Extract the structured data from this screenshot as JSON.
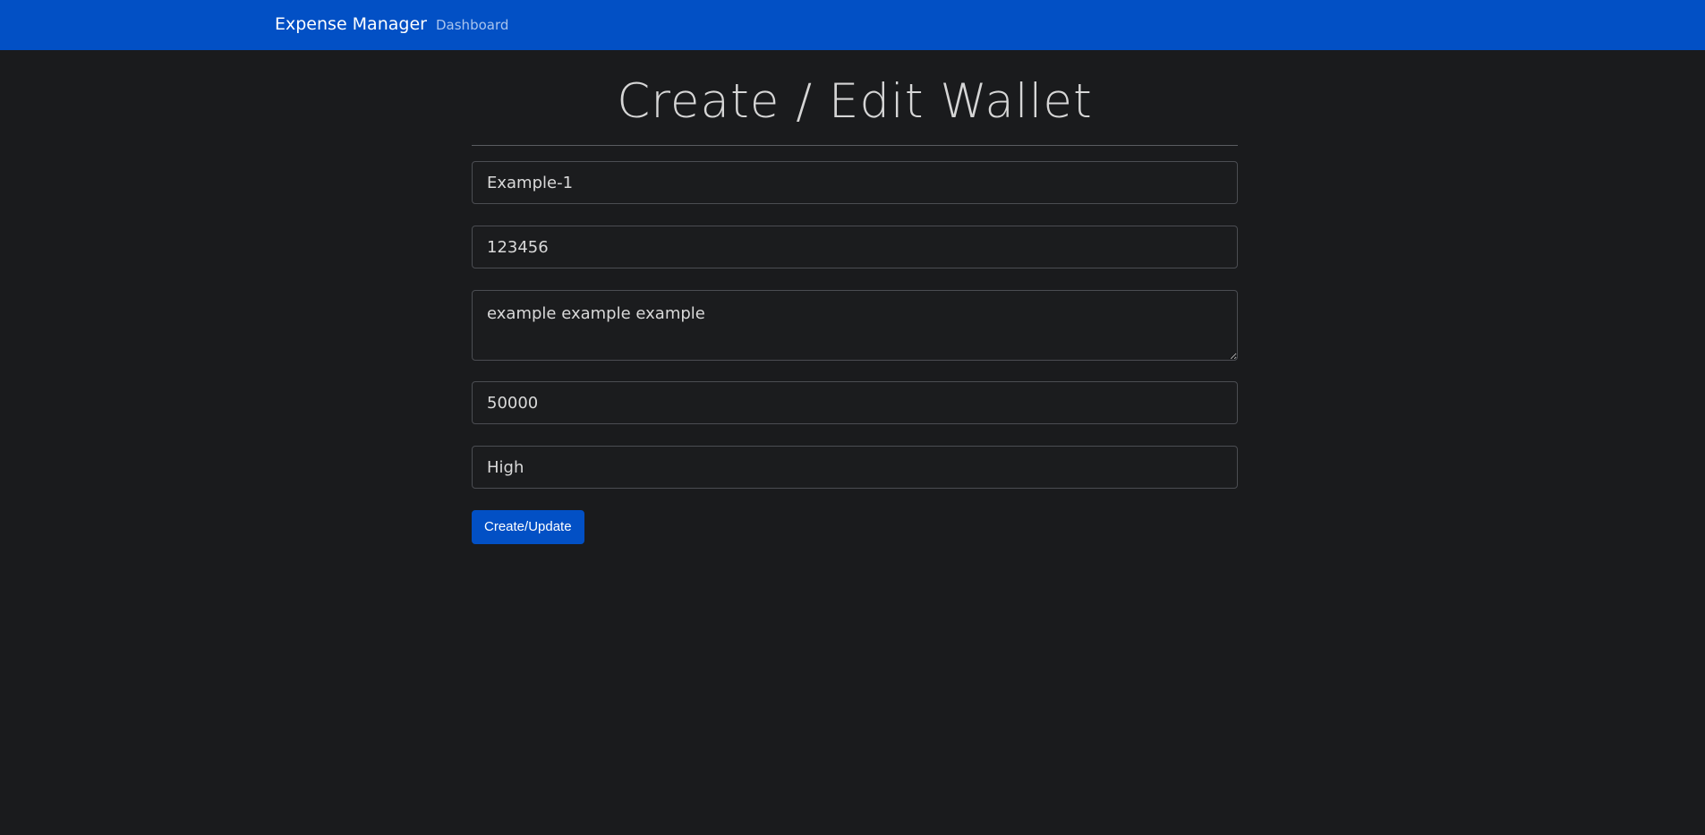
{
  "navbar": {
    "brand": "Expense Manager",
    "links": [
      {
        "label": "Dashboard"
      }
    ]
  },
  "page": {
    "title": "Create / Edit Wallet"
  },
  "form": {
    "fields": [
      {
        "value": "Example-1"
      },
      {
        "value": "123456"
      },
      {
        "value": "example example example"
      },
      {
        "value": "50000"
      },
      {
        "value": "High"
      }
    ],
    "submit_label": "Create/Update"
  },
  "colors": {
    "navbar_bg": "#0250c5",
    "page_bg": "#1a1b1d",
    "button_bg": "#0250c5",
    "field_border": "#4b4d52"
  }
}
